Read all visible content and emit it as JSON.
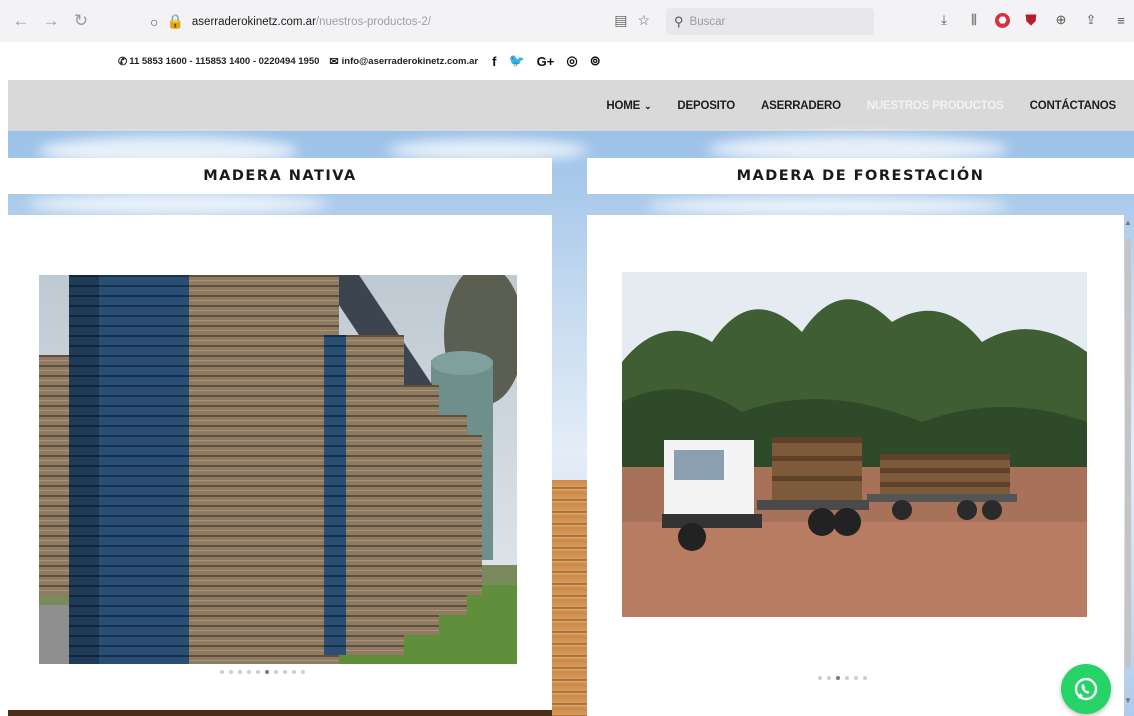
{
  "browser": {
    "url_host": "aserraderokinetz.com.ar",
    "url_path": "/nuestros-productos-2/",
    "search_placeholder": "Buscar"
  },
  "contact": {
    "phones": "11 5853 1600 - 115853 1400 - 0220494 1950",
    "email": "info@aserraderokinetz.com.ar",
    "social_icons": [
      "facebook-icon",
      "twitter-icon",
      "google-plus-icon",
      "instagram-icon",
      "rss-icon"
    ]
  },
  "nav": {
    "items": [
      {
        "label": "HOME",
        "has_dropdown": true
      },
      {
        "label": "DEPOSITO"
      },
      {
        "label": "ASERRADERO"
      },
      {
        "label": "NUESTROS PRODUCTOS",
        "active": true
      },
      {
        "label": "CONTÁCTANOS"
      }
    ]
  },
  "products": {
    "left_title": "MADERA NATIVA",
    "right_title": "MADERA DE FORESTACIÓN"
  },
  "carousel": {
    "left_dots": 10,
    "left_active": 6,
    "right_dots": 6,
    "right_active": 3
  },
  "colors": {
    "nav_bg": "#d9d9d9",
    "whatsapp": "#25d366",
    "active_nav": "#f2f2f2"
  }
}
